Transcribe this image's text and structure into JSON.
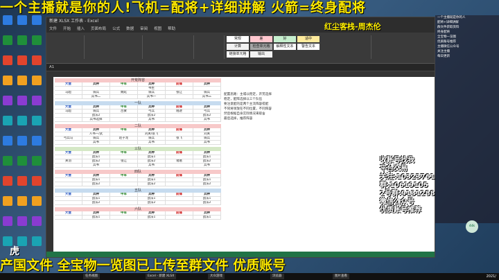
{
  "banner_top": "一个主播就是你的人!飞机=配将+详细讲解 火箭=终身配将",
  "banner_bottom": "产国文件 全宝物一览图已上传至群文件 优质账号",
  "watermark": "红尘客栈-周杰伦",
  "excel": {
    "title": "新建 XLSX 工作表 - Excel",
    "menu": [
      "文件",
      "开始",
      "插入",
      "页面布局",
      "公式",
      "数据",
      "审阅",
      "视图",
      "帮助"
    ],
    "cell_ref": "A1",
    "styles": [
      "常规",
      "差",
      "好",
      "适中",
      "计算",
      "检查单元格",
      "解释性文本",
      "警告文本",
      "链接单元格",
      "输出"
    ],
    "sections": [
      {
        "title": "开荒阵容",
        "color": "pink",
        "head": [
          "大营",
          "兵种",
          "中军",
          "兵种",
          "前锋",
          "兵种"
        ],
        "rows": [
          [
            "",
            "",
            "",
            "书生",
            "",
            ""
          ],
          [
            "马超",
            "骑兵",
            "魏延",
            "骑兵",
            "张辽",
            "骑兵"
          ],
          [
            "",
            "兵书二",
            "",
            "兵书一",
            "",
            "兵书三"
          ]
        ]
      },
      {
        "title": "一队",
        "color": "blue",
        "head": [
          "大营",
          "兵种",
          "中军",
          "兵种",
          "前锋",
          "兵种"
        ],
        "rows": [
          [
            "马超",
            "骑兵",
            "吕蒙",
            "弓兵",
            "陆逊",
            "弓兵"
          ],
          [
            "",
            "战法2",
            "",
            "战法2",
            "",
            "战法2"
          ],
          [
            "",
            "兵书选择",
            "",
            "兵书",
            "",
            "兵书"
          ]
        ]
      },
      {
        "title": "二队",
        "color": "pink",
        "head": [
          "大营",
          "兵种",
          "中军",
          "兵种",
          "前锋",
          "兵种"
        ],
        "rows": [
          [
            "",
            "人书一/武",
            "",
            "刘关/张飞",
            "",
            "刘关"
          ],
          [
            "弓兵马",
            "骑兵",
            "赵子龙",
            "骑兵",
            "张飞",
            "骑兵"
          ],
          [
            "",
            "兵书",
            "",
            "兵书",
            "",
            "兵书"
          ]
        ]
      },
      {
        "title": "三队",
        "color": "green",
        "head": [
          "大营",
          "兵种",
          "中军",
          "兵种",
          "前锋",
          "兵种"
        ],
        "rows": [
          [
            "",
            "战法1",
            "",
            "战法1",
            "",
            "战法1"
          ],
          [
            "关羽",
            "战法2",
            "张辽",
            "战法2",
            "诸葛",
            "战法2"
          ],
          [
            "",
            "兵书",
            "",
            "兵书",
            "",
            "兵书"
          ]
        ]
      },
      {
        "title": "四队",
        "color": "pink",
        "head": [
          "大营",
          "兵种",
          "中军",
          "兵种",
          "前锋",
          "兵种"
        ],
        "rows": [
          [
            "",
            "战法1",
            "",
            "战法1",
            "",
            "战法1"
          ],
          [
            "",
            "战法2",
            "",
            "战法2",
            "",
            "战法2"
          ]
        ]
      },
      {
        "title": "五队",
        "color": "blue",
        "head": [
          "大营",
          "兵种",
          "中军",
          "兵种",
          "前锋",
          "兵种"
        ],
        "rows": [
          [
            "",
            "战法1",
            "",
            "战法1",
            "",
            "战法1"
          ],
          [
            "",
            "战法2",
            "",
            "战法2",
            "",
            "战法2"
          ]
        ]
      },
      {
        "title": "六队",
        "color": "pink",
        "head": [
          "大营",
          "兵种",
          "中军",
          "兵种",
          "前锋",
          "兵种"
        ],
        "rows": [
          [
            "",
            "战法1",
            "",
            "战法1",
            "",
            "战法1"
          ]
        ]
      }
    ],
    "notes": [
      "配置思路：主城以稳定，开荒选择",
      "稳定，配阵选择以三个队伍",
      "要注意配的是两个主流阵容搭配",
      "不同将领放在不同位置，不同阵容",
      "然后根据自身实际情况来取舍",
      "最后选择，推荐阵容"
    ]
  },
  "right_panel": [
    "一个主播就是你的人",
    "配将+详细讲解",
    "群文件获取资料",
    "终身配将",
    "全宝物一览图",
    "优质账号推荐",
    "主播微信公众号",
    "关注主播",
    "每日更新"
  ],
  "ads": [
    "收账号找我",
    "平台交易",
    "关注:10323761",
    "群:10619105",
    "2号群:9131288",
    "微信公众号",
    "优质账号推荐"
  ],
  "avatar_label": "44k",
  "logo_text": "虎",
  "taskbar": {
    "items": [
      "任务视图",
      "Excel - 新建 XLSX",
      "大众游戏",
      "浏览器",
      "图片查看"
    ],
    "time": "2021/"
  }
}
